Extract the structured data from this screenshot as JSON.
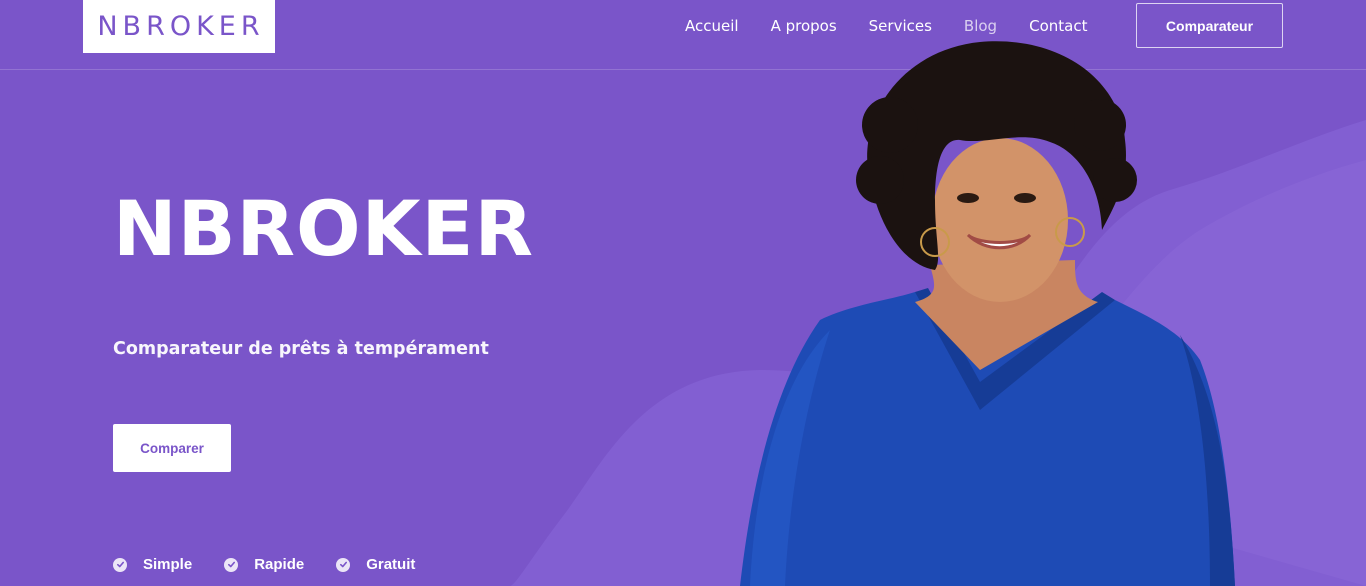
{
  "brand": {
    "logo_text": "NBROKER"
  },
  "nav": {
    "items": [
      {
        "label": "Accueil",
        "name": "nav-link-accueil"
      },
      {
        "label": "A propos",
        "name": "nav-link-a-propos"
      },
      {
        "label": "Services",
        "name": "nav-link-services"
      },
      {
        "label": "Blog",
        "name": "nav-link-blog"
      },
      {
        "label": "Contact",
        "name": "nav-link-contact"
      }
    ],
    "cta_label": "Comparateur"
  },
  "hero": {
    "title": "NBROKER",
    "subtitle": "Comparateur de prêts à tempérament",
    "button_label": "Comparer",
    "features": [
      "Simple",
      "Rapide",
      "Gratuit"
    ],
    "image_icon": "woman-portrait-image"
  },
  "colors": {
    "brand_purple": "#7a55c9",
    "wave_light": "#8a67d6",
    "blouse_blue": "#1e4bb5",
    "white": "#ffffff"
  }
}
